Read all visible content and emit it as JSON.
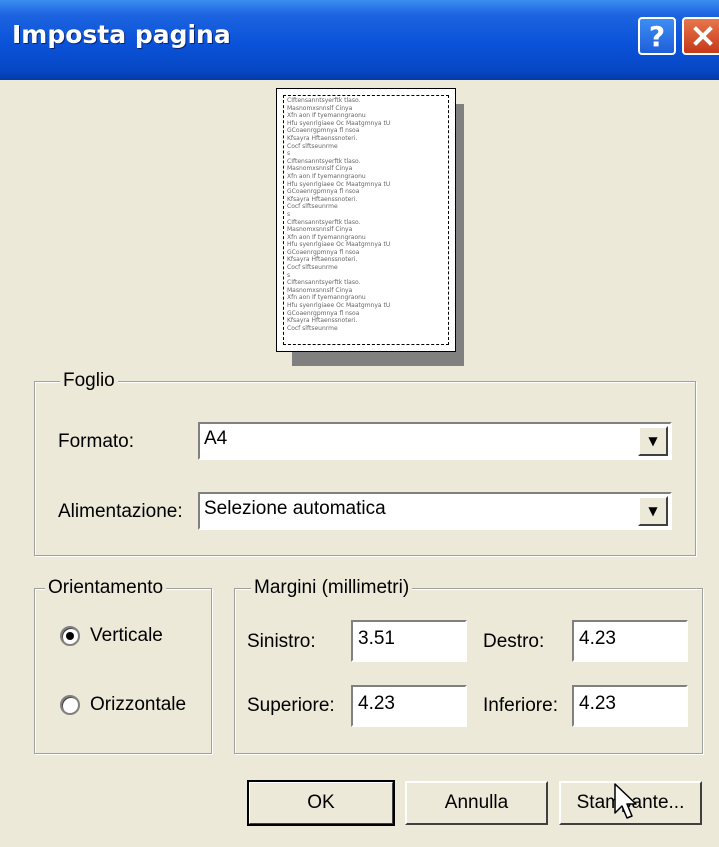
{
  "window": {
    "title": "Imposta pagina"
  },
  "titlebar": {
    "help_label": "?",
    "close_label": "X"
  },
  "preview": {
    "sample_lines": [
      "CIftensanntsyerftk tlaso.",
      "Masnomxsnnslf Cinya",
      "Xfn aon If tyemanngraonu",
      "  Hfu syenrlgiaee Oc Maatgmnya tU",
      "GCoaenrgpmnya fl nsoa",
      "Kfsayra Hftaenssnoteri.",
      "Cocf slftseunrme",
      "s",
      "CIftensanntsyerftk tlaso.",
      "Masnomxsnnslf Cinya",
      "Xfn aon If tyemanngraonu",
      "  Hfu syenrlgiaee Oc Maatgmnya tU",
      "GCoaenrgpmnya fl nsoa",
      "Kfsayra Hftaenssnoteri.",
      "Cocf slftseunrme",
      "s",
      "CIftensanntsyerftk tlaso.",
      "Masnomxsnnslf Cinya",
      "Xfn aon If tyemanngraonu",
      "  Hfu syenrlgiaee Oc Maatgmnya tU",
      "GCoaenrgpmnya fl nsoa",
      "Kfsayra Hftaenssnoteri.",
      "Cocf slftseunrme",
      "s",
      "CIftensanntsyerftk tlaso.",
      "Masnomxsnnslf Cinya",
      "Xfn aon If tyemanngraonu",
      "  Hfu syenrlgiaee Oc Maatgmnya tU",
      "GCoaenrgpmnya fl nsoa",
      "Kfsayra Hftaenssnoteri.",
      "Cocf slftseunrme"
    ]
  },
  "paper": {
    "group_label": "Foglio",
    "size_label": "Formato:",
    "size_value": "A4",
    "source_label": "Alimentazione:",
    "source_value": "Selezione automatica"
  },
  "orientation": {
    "group_label": "Orientamento",
    "portrait_label": "Verticale",
    "landscape_label": "Orizzontale",
    "selected": "portrait"
  },
  "margins": {
    "group_label": "Margini (millimetri)",
    "left_label": "Sinistro:",
    "left_value": "3.51",
    "right_label": "Destro:",
    "right_value": "4.23",
    "top_label": "Superiore:",
    "top_value": "4.23",
    "bottom_label": "Inferiore:",
    "bottom_value": "4.23"
  },
  "buttons": {
    "ok": "OK",
    "cancel": "Annulla",
    "printer": "Stampante..."
  },
  "colors": {
    "dialog_bg": "#ece9d8",
    "titlebar_blue": "#0a52d9",
    "close_red": "#c5391a"
  }
}
